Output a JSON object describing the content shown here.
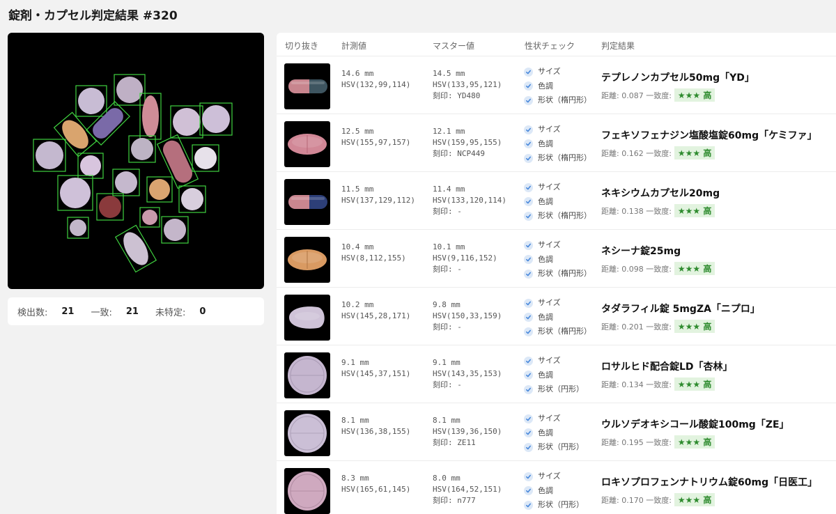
{
  "title": "錠剤・カプセル判定結果 #320",
  "summary": {
    "detected_label": "検出数:",
    "detected": "21",
    "match_label": "一致:",
    "match": "21",
    "unknown_label": "未特定:",
    "unknown": "0"
  },
  "table": {
    "headers": {
      "crop": "切り抜き",
      "measured": "計測値",
      "master": "マスター値",
      "check": "性状チェック",
      "result": "判定結果"
    },
    "rows": [
      {
        "m_size": "14.6 mm",
        "m_hsv": "HSV(132,99,114)",
        "s_size": "14.5 mm",
        "s_hsv": "HSV(133,95,121)",
        "s_imprint": "刻印: YD480",
        "c1": "サイズ",
        "c2": "色調",
        "c3": "形状（楕円形）",
        "name": "テプレノンカプセル50mg「YD」",
        "score": "距離: 0.087  一致度:",
        "badge": "★★★ 高",
        "thumb": "capsule",
        "color": "#c8858e",
        "color2": "#3e5560"
      },
      {
        "m_size": "12.5 mm",
        "m_hsv": "HSV(155,97,157)",
        "s_size": "12.1 mm",
        "s_hsv": "HSV(159,95,155)",
        "s_imprint": "刻印: NCP449",
        "c1": "サイズ",
        "c2": "色調",
        "c3": "形状（楕円形）",
        "name": "フェキソフェナジン塩酸塩錠60mg「ケミファ」",
        "score": "距離: 0.162  一致度:",
        "badge": "★★★ 高",
        "thumb": "oval",
        "color": "#d18796",
        "color2": "#b56676"
      },
      {
        "m_size": "11.5 mm",
        "m_hsv": "HSV(137,129,112)",
        "s_size": "11.4 mm",
        "s_hsv": "HSV(133,120,114)",
        "s_imprint": "刻印: -",
        "c1": "サイズ",
        "c2": "色調",
        "c3": "形状（楕円形）",
        "name": "ネキシウムカプセル20mg",
        "score": "距離: 0.138  一致度:",
        "badge": "★★★ 高",
        "thumb": "capsule",
        "color": "#c9868f",
        "color2": "#2d3f78"
      },
      {
        "m_size": "10.4 mm",
        "m_hsv": "HSV(8,112,155)",
        "s_size": "10.1 mm",
        "s_hsv": "HSV(9,116,152)",
        "s_imprint": "刻印: -",
        "c1": "サイズ",
        "c2": "色調",
        "c3": "形状（楕円形）",
        "name": "ネシーナ錠25mg",
        "score": "距離: 0.098  一致度:",
        "badge": "★★★ 高",
        "thumb": "oval",
        "color": "#d99a62",
        "color2": "#b07545"
      },
      {
        "m_size": "10.2 mm",
        "m_hsv": "HSV(145,28,171)",
        "s_size": "9.8 mm",
        "s_hsv": "HSV(150,33,159)",
        "s_imprint": "刻印: -",
        "c1": "サイズ",
        "c2": "色調",
        "c3": "形状（楕円形）",
        "name": "タダラフィル錠 5mgZA「ニプロ」",
        "score": "距離: 0.201  一致度:",
        "badge": "★★★ 高",
        "thumb": "teardrop",
        "color": "#cfc3d8",
        "color2": "#a89cb3"
      },
      {
        "m_size": "9.1 mm",
        "m_hsv": "HSV(145,37,151)",
        "s_size": "9.1 mm",
        "s_hsv": "HSV(143,35,153)",
        "s_imprint": "刻印: -",
        "c1": "サイズ",
        "c2": "色調",
        "c3": "形状（円形）",
        "name": "ロサルヒド配合錠LD「杏林」",
        "score": "距離: 0.134  一致度:",
        "badge": "★★★ 高",
        "thumb": "round",
        "color": "#c5b6cf",
        "color2": "#9c8ea8"
      },
      {
        "m_size": "8.1 mm",
        "m_hsv": "HSV(136,38,155)",
        "s_size": "8.1 mm",
        "s_hsv": "HSV(139,36,150)",
        "s_imprint": "刻印: ZE11",
        "c1": "サイズ",
        "c2": "色調",
        "c3": "形状（円形）",
        "name": "ウルソデオキシコール酸錠100mg「ZE」",
        "score": "距離: 0.195  一致度:",
        "badge": "★★★ 高",
        "thumb": "round",
        "color": "#cbbfd6",
        "color2": "#9f93ab"
      },
      {
        "m_size": "8.3 mm",
        "m_hsv": "HSV(165,61,145)",
        "s_size": "8.0 mm",
        "s_hsv": "HSV(164,52,151)",
        "s_imprint": "刻印: n777",
        "c1": "サイズ",
        "c2": "色調",
        "c3": "形状（円形）",
        "name": "ロキソプロフェンナトリウム錠60mg「日医工」",
        "score": "距離: 0.170  一致度:",
        "badge": "★★★ 高",
        "thumb": "round",
        "color": "#cfa9bf",
        "color2": "#a37f95"
      }
    ]
  },
  "colors": {
    "accent_check": "#4a89dc",
    "badge_bg": "#e2f3df",
    "badge_fg": "#2e8b2e",
    "detect_box": "#3fd13f"
  }
}
